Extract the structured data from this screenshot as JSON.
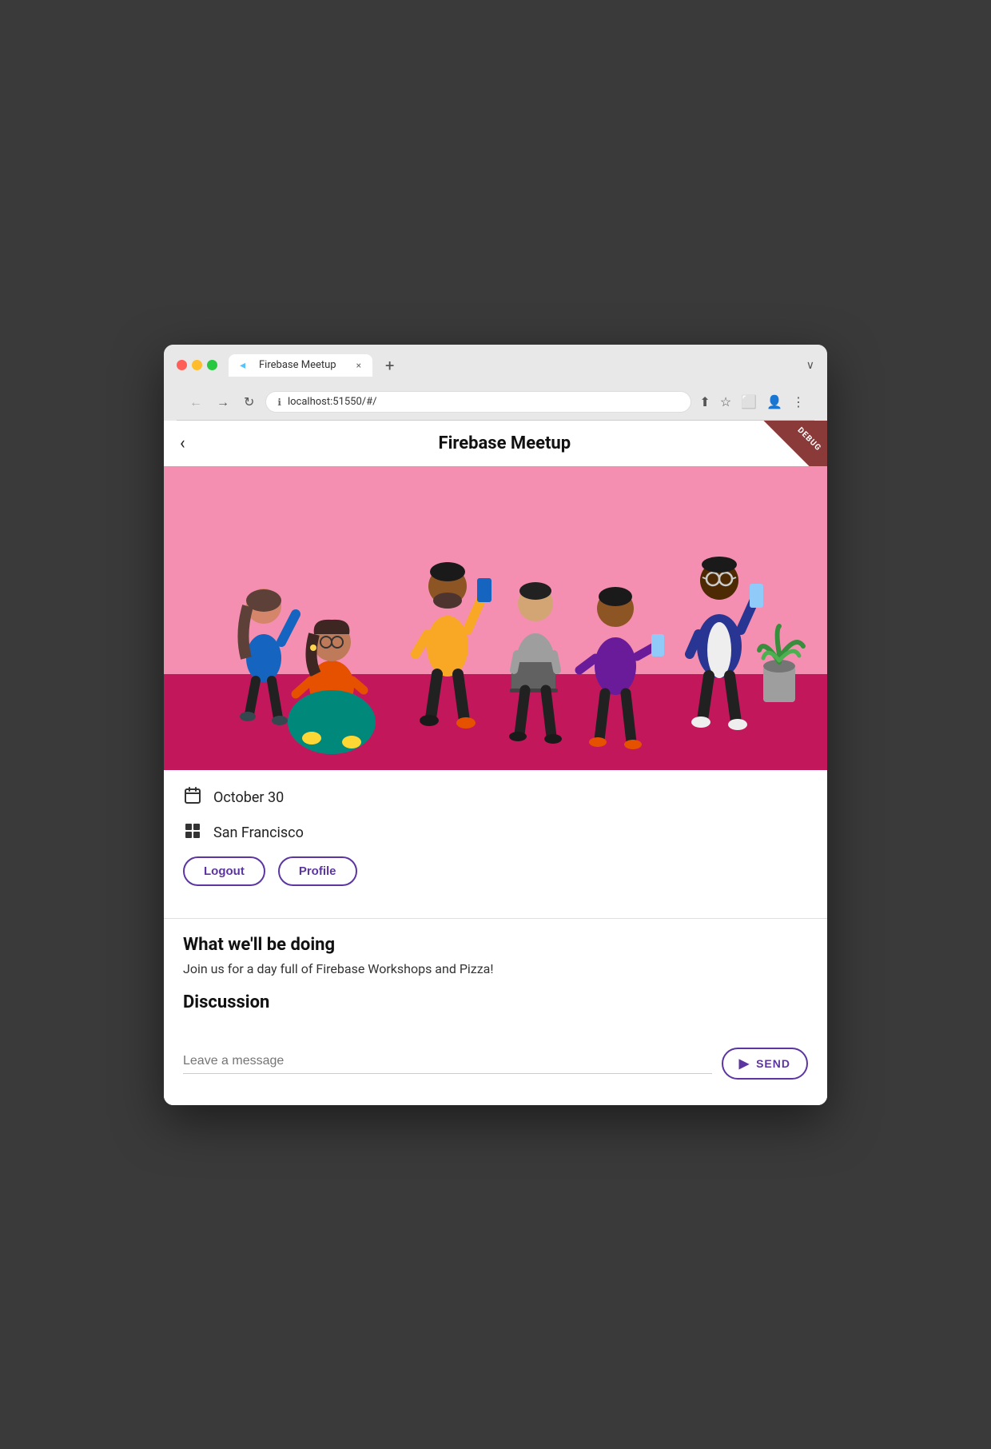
{
  "browser": {
    "tab_title": "Firebase Meetup",
    "tab_close": "×",
    "tab_new": "+",
    "tab_chevron": "∨",
    "nav_back": "←",
    "nav_forward": "→",
    "nav_refresh": "↻",
    "address": "localhost:51550/#/",
    "toolbar_share": "⬆",
    "toolbar_bookmark": "☆",
    "toolbar_sidebar": "⬜",
    "toolbar_profile": "👤",
    "toolbar_more": "⋮"
  },
  "app": {
    "back_icon": "‹",
    "title": "Firebase Meetup",
    "debug_label": "DEBUG",
    "date_icon": "📅",
    "date": "October 30",
    "location_icon": "🏢",
    "location": "San Francisco",
    "logout_label": "Logout",
    "profile_label": "Profile",
    "what_title": "What we'll be doing",
    "what_body": "Join us for a day full of Firebase Workshops and Pizza!",
    "discussion_title": "Discussion",
    "message_placeholder": "Leave a message",
    "send_label": "SEND"
  },
  "colors": {
    "accent": "#5c35a0",
    "hero_pink": "#f48fb1",
    "hero_red": "#c2185b",
    "debug_brown": "#8B3A3A"
  }
}
